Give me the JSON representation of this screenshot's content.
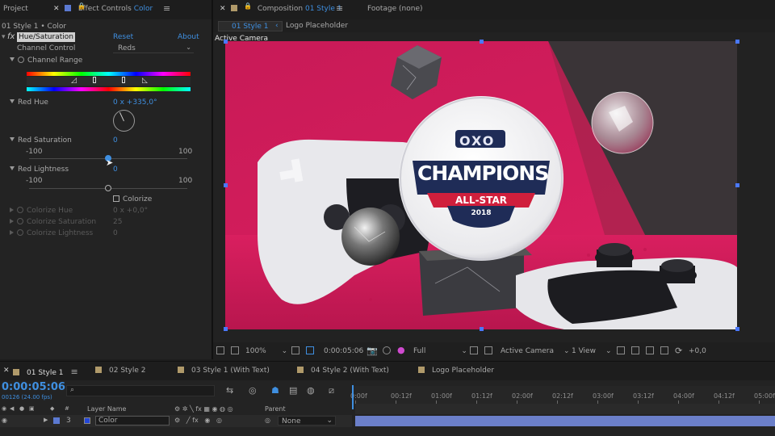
{
  "left_tabs": {
    "project": "Project",
    "effect_controls_prefix": "Effect Controls",
    "effect_controls_layer": "Color"
  },
  "right_tabs": {
    "composition_prefix": "Composition",
    "composition_name": "01 Style 1",
    "footage": "Footage (none)"
  },
  "viewer_crumbs": {
    "active": "01 Style 1",
    "next": "Logo Placeholder"
  },
  "effect_controls": {
    "layer_path": "01 Style 1 • Color",
    "fx_label": "fx",
    "effect_name": "Hue/Saturation",
    "reset": "Reset",
    "about": "About",
    "channel_control_label": "Channel Control",
    "channel_control_value": "Reds",
    "channel_range_label": "Channel Range",
    "red_hue_label": "Red Hue",
    "red_hue_value": "0 x +335,0°",
    "red_saturation_label": "Red Saturation",
    "red_saturation_value": "0",
    "sat_min": "-100",
    "sat_max": "100",
    "red_lightness_label": "Red Lightness",
    "red_lightness_value": "0",
    "light_min": "-100",
    "light_max": "100",
    "colorize_label": "Colorize",
    "colorize_hue_label": "Colorize Hue",
    "colorize_hue_value": "0 x +0,0°",
    "colorize_saturation_label": "Colorize Saturation",
    "colorize_saturation_value": "25",
    "colorize_lightness_label": "Colorize Lightness",
    "colorize_lightness_value": "0"
  },
  "viewer": {
    "active_camera_label": "Active Camera",
    "logo": {
      "top": "OXO",
      "main": "CHAMPIONS",
      "banner": "ALL-STAR",
      "year": "2018"
    }
  },
  "viewer_toolbar": {
    "zoom": "100%",
    "timecode": "0:00:05:06",
    "resolution": "Full",
    "camera": "Active Camera",
    "view": "1 View",
    "exposure": "+0,0"
  },
  "timeline_tabs": [
    {
      "label": "01 Style 1",
      "color": "#b09a6a"
    },
    {
      "label": "02 Style 2",
      "color": "#b09a6a"
    },
    {
      "label": "03 Style 1 (With Text)",
      "color": "#b09a6a"
    },
    {
      "label": "04 Style 2 (With Text)",
      "color": "#b09a6a"
    },
    {
      "label": "Logo Placeholder",
      "color": "#b09a6a"
    }
  ],
  "timeline": {
    "current_time": "0:00:05:06",
    "frames_fps": "00126 (24.00 fps)",
    "search_placeholder": "",
    "col_layer_name": "Layer Name",
    "col_parent": "Parent",
    "layer_number": "3",
    "layer_name": "Color",
    "layer_parent": "None",
    "ruler": [
      "0:00f",
      "00:12f",
      "01:00f",
      "01:12f",
      "02:00f",
      "02:12f",
      "03:00f",
      "03:12f",
      "04:00f",
      "04:12f",
      "05:00f"
    ]
  },
  "colors": {
    "accent_blue": "#3f8fe0",
    "magenta_bg": "#d41d5c",
    "layer_bar": "#6b7fc9",
    "logo_navy": "#1f2c57",
    "logo_red": "#d01f3c"
  }
}
